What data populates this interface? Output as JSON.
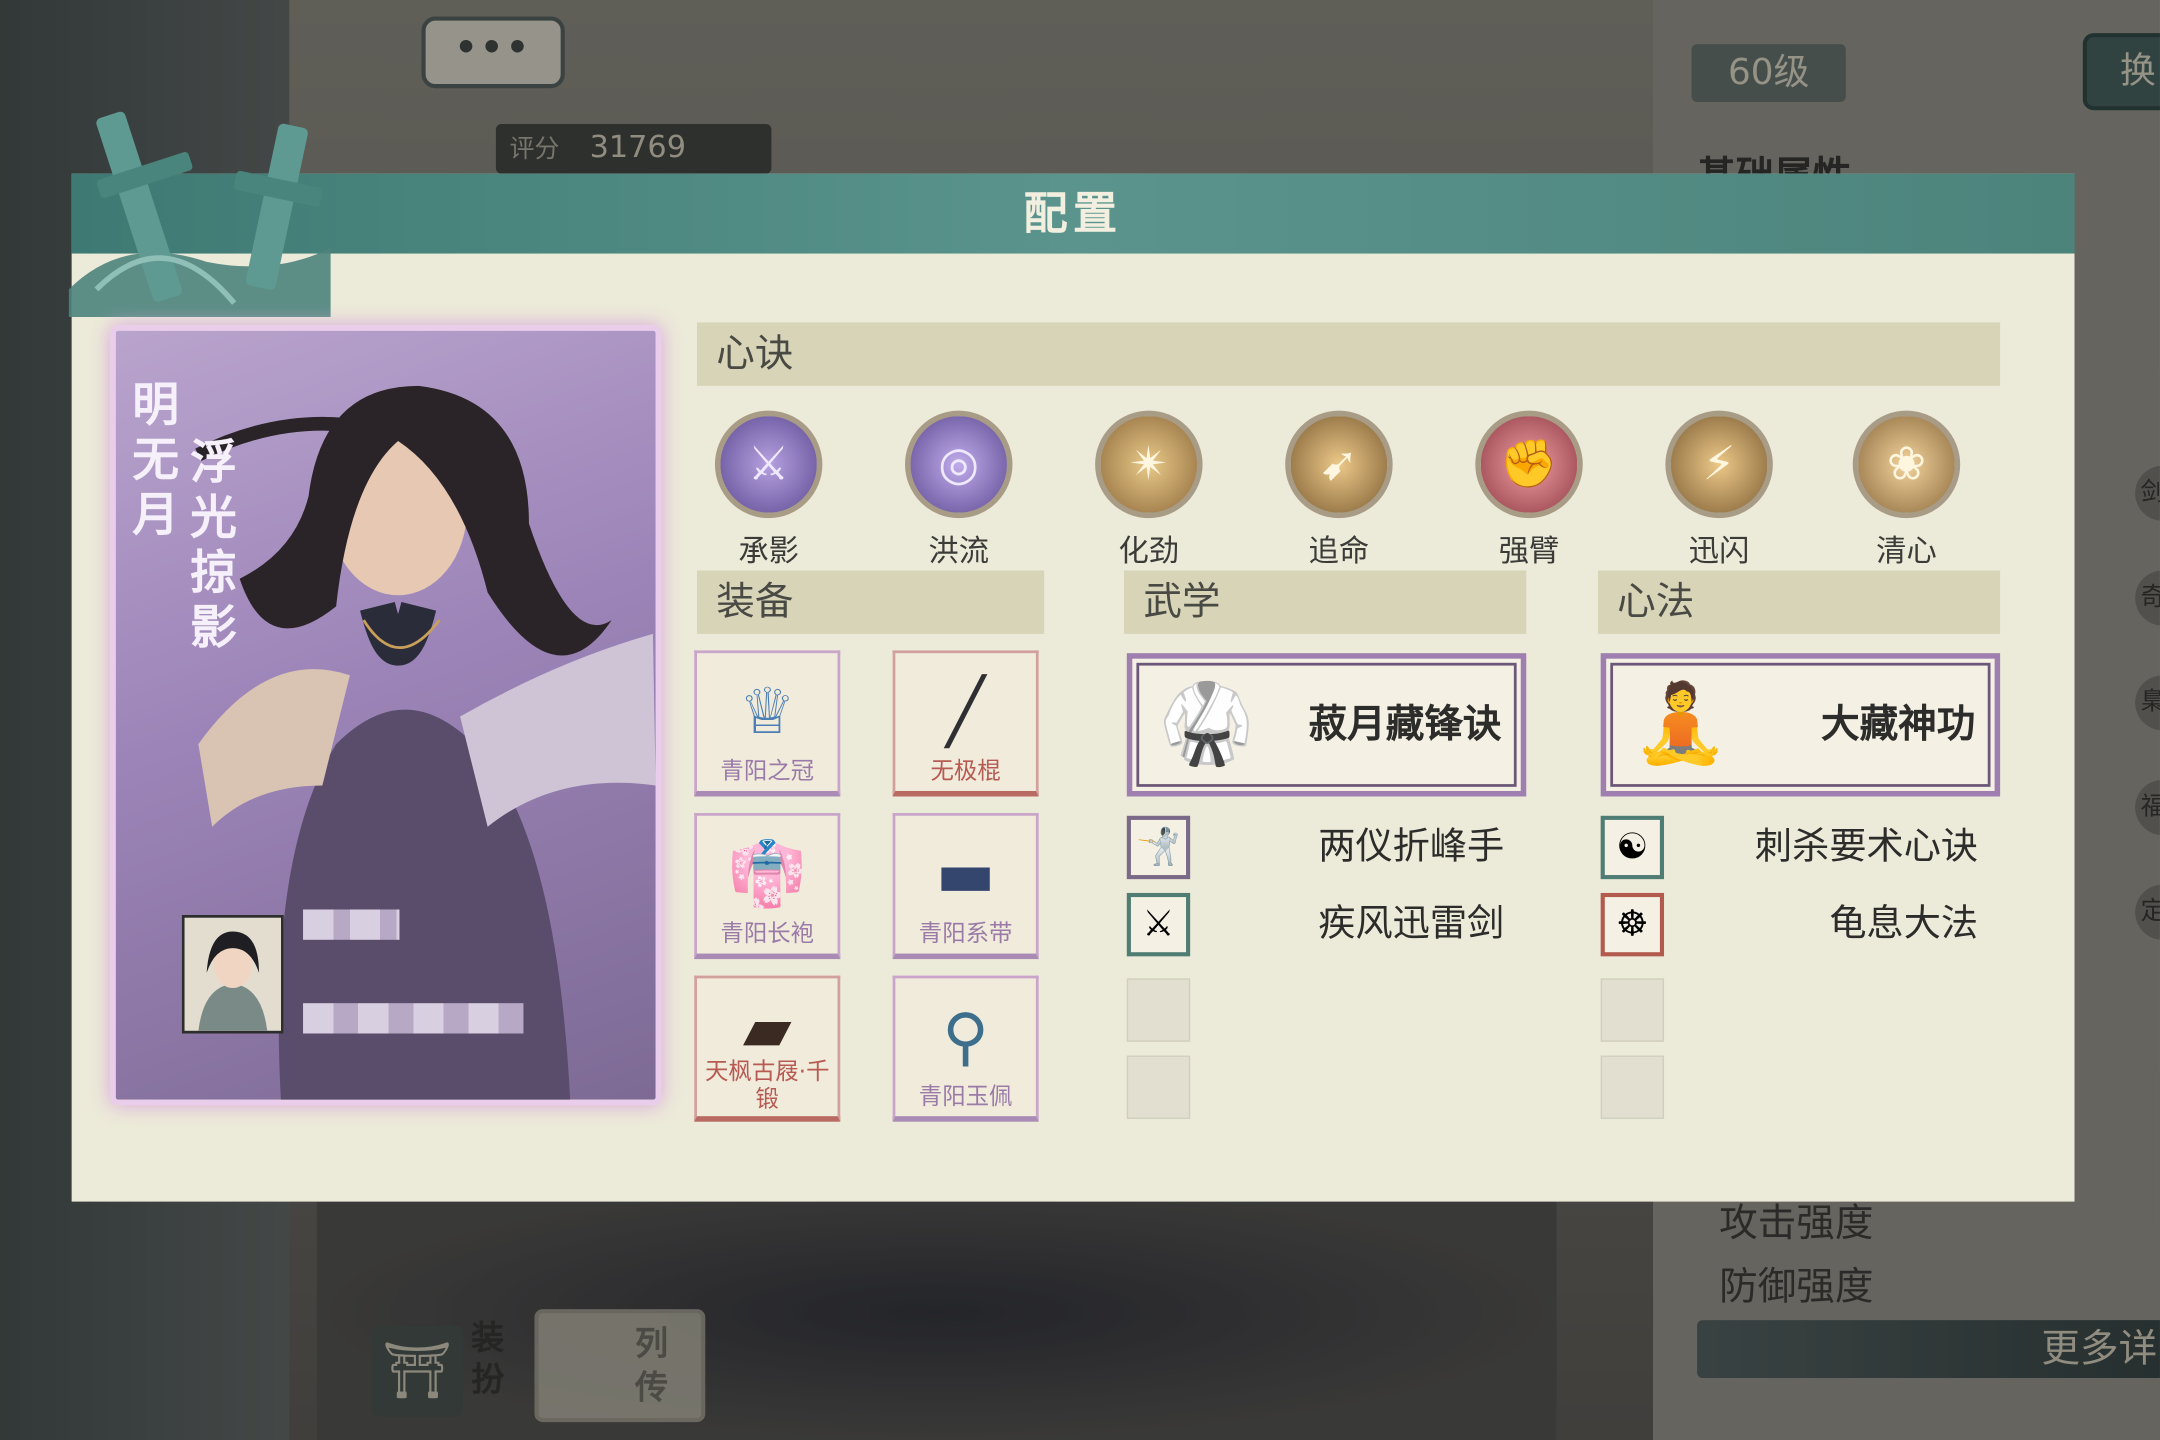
{
  "background": {
    "chat_bubble": "•••",
    "score_label": "评分",
    "score_value": "31769",
    "level": "60级",
    "top_right_button": "换",
    "base_attr_heading": "基础属性",
    "stats": [
      "攻击强度",
      "防御强度"
    ],
    "more_details": "更多详",
    "side_tabs": [
      "剑",
      "奇",
      "梟",
      "福",
      "定"
    ],
    "dress_label": "装扮",
    "bio_label": "列传"
  },
  "panel": {
    "title": "配置",
    "character": {
      "name": "明无月",
      "title": "浮光掠影"
    },
    "sections": {
      "xinjue": "心诀",
      "equipment": "装备",
      "martial": "武学",
      "xinfa": "心法"
    },
    "skills": [
      {
        "label": "承影",
        "icon": "purple-blades-icon"
      },
      {
        "label": "洪流",
        "icon": "purple-swirl-icon"
      },
      {
        "label": "化劲",
        "icon": "gold-strike-icon"
      },
      {
        "label": "追命",
        "icon": "gold-dash-icon"
      },
      {
        "label": "强臂",
        "icon": "red-fist-icon"
      },
      {
        "label": "迅闪",
        "icon": "gold-flash-icon"
      },
      {
        "label": "清心",
        "icon": "gold-lotus-icon"
      }
    ],
    "equipment": [
      {
        "label": "青阳之冠",
        "icon": "crown-icon",
        "rarity": "purple"
      },
      {
        "label": "无极棍",
        "icon": "staff-icon",
        "rarity": "red"
      },
      {
        "label": "青阳长袍",
        "icon": "robe-icon",
        "rarity": "purple"
      },
      {
        "label": "青阳系带",
        "icon": "belt-icon",
        "rarity": "purple"
      },
      {
        "label": "天枫古屐·千锻",
        "icon": "clogs-icon",
        "rarity": "red"
      },
      {
        "label": "青阳玉佩",
        "icon": "jade-pendant-icon",
        "rarity": "purple"
      }
    ],
    "martial": {
      "main": "菽月藏锋诀",
      "subs": [
        "两仪折峰手",
        "疾风迅雷剑"
      ]
    },
    "xinfa": {
      "main": "大藏神功",
      "subs": [
        "刺杀要术心诀",
        "龟息大法"
      ]
    },
    "colors": {
      "header": "#4c847c",
      "panel_bg": "#ecead9",
      "section_bar": "#d8d4b8",
      "purple_frame": "#9f7fb0",
      "card_purple": "#9c84b8"
    }
  }
}
